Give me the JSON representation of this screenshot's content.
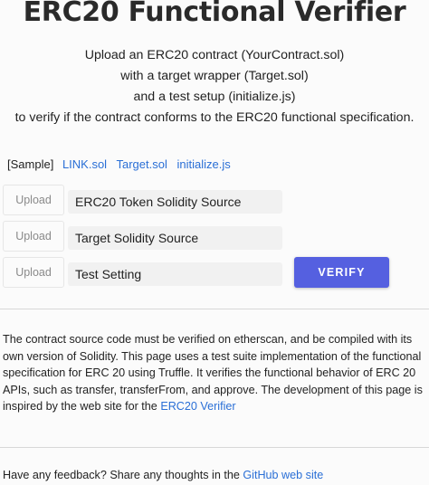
{
  "header": {
    "title": "ERC20 Functional Verifier"
  },
  "description": {
    "line1": "Upload an ERC20 contract (YourContract.sol)",
    "line2": "with a target wrapper (Target.sol)",
    "line3": "and a test setup (initialize.js)",
    "line4": "to verify if the contract conforms to the ERC20 functional specification."
  },
  "samples": {
    "label": "[Sample]",
    "links": [
      "LINK.sol",
      "Target.sol",
      "initialize.js"
    ]
  },
  "uploads": [
    {
      "button_label": "Upload",
      "field_text": "ERC20 Token Solidity Source"
    },
    {
      "button_label": "Upload",
      "field_text": "Target Solidity Source"
    },
    {
      "button_label": "Upload",
      "field_text": "Test Setting"
    }
  ],
  "verify": {
    "label": "VERIFY",
    "color": "#5560e0"
  },
  "info": {
    "text": "The contract source code must be verified on etherscan, and be compiled with its own version of Solidity. This page uses a test suite implementation of the functional specification for ERC 20 using Truffle. It verifies the functional behavior of ERC 20 APIs, such as transfer, transferFrom, and approve. The development of this page is inspired by the web site for the",
    "link_text": "ERC20 Verifier"
  },
  "feedback": {
    "text": "Have any feedback? Share any thoughts in the",
    "link_text": "GitHub web site"
  },
  "colors": {
    "link": "#2a6fd6",
    "background": "#fbfbfb"
  }
}
